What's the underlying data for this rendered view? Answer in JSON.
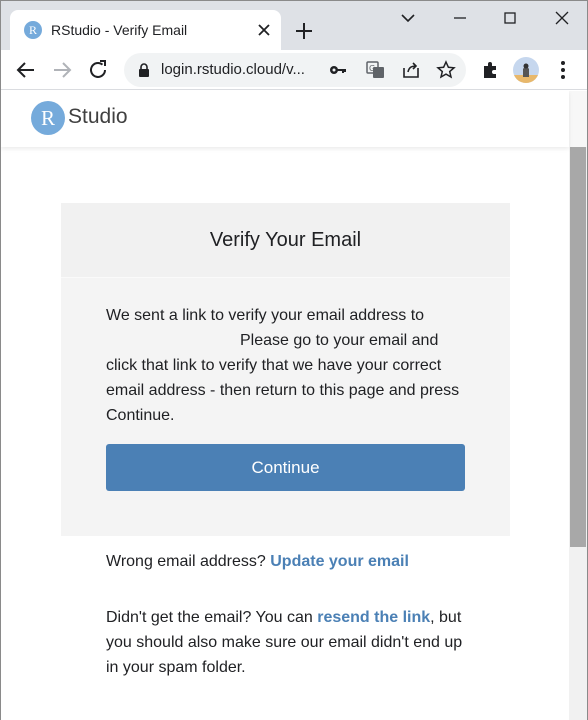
{
  "browser": {
    "tab": {
      "title": "RStudio - Verify Email",
      "favicon_letter": "R"
    },
    "url": "login.rstudio.cloud/v...",
    "icons": [
      "back-icon",
      "forward-icon",
      "reload-icon",
      "lock-icon",
      "key-icon",
      "translate-icon",
      "share-icon",
      "star-icon",
      "extensions-icon",
      "avatar",
      "menu-icon"
    ]
  },
  "site": {
    "logo_letter": "R",
    "logo_text": "Studio"
  },
  "card": {
    "title": "Verify Your Email",
    "body_line1": "We sent a link to verify your email address to",
    "body_rest": "Please go to your email and click that link to verify that we have your correct email address - then return to this page and press Continue.",
    "button": "Continue"
  },
  "wrong_email": {
    "prefix": "Wrong email address?",
    "link": "Update your email"
  },
  "resend": {
    "prefix": "Didn't get the email? You can",
    "link": "resend the link",
    "suffix": ", but you should also make sure our email didn't end up in your spam folder."
  },
  "colors": {
    "accent": "#4b80b5",
    "logo": "#75aadb"
  }
}
